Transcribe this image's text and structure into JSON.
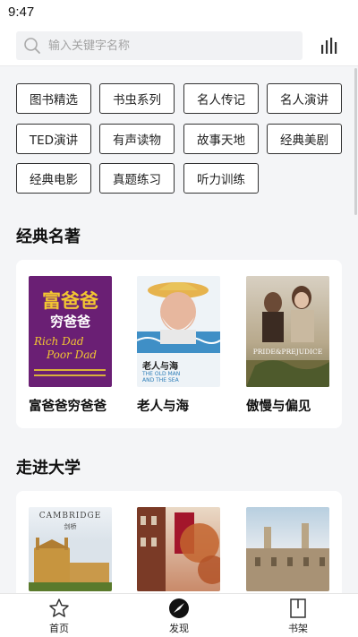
{
  "status": {
    "time": "9:47"
  },
  "search": {
    "placeholder": "输入关键字名称"
  },
  "tags": [
    "图书精选",
    "书虫系列",
    "名人传记",
    "名人演讲",
    "TED演讲",
    "有声读物",
    "故事天地",
    "经典美剧",
    "经典电影",
    "真题练习",
    "听力训练"
  ],
  "sections": [
    {
      "title": "经典名著",
      "books": [
        {
          "title": "富爸爸穷爸爸",
          "cover_text": [
            "富爸爸",
            "穷爸爸",
            "Rich Dad",
            "Poor Dad"
          ]
        },
        {
          "title": "老人与海",
          "cover_text": [
            "老人与海",
            "THE OLD MAN",
            "AND THE SEA"
          ]
        },
        {
          "title": "傲慢与偏见",
          "cover_text": [
            "PRIDE&PREJUDICE"
          ]
        }
      ]
    },
    {
      "title": "走进大学",
      "books": [
        {
          "title": "",
          "cover_text": [
            "CAMBRIDGE",
            "剑桥"
          ]
        },
        {
          "title": "",
          "cover_text": []
        },
        {
          "title": "",
          "cover_text": []
        }
      ]
    }
  ],
  "tabbar": [
    {
      "label": "首页",
      "icon": "star-icon"
    },
    {
      "label": "发现",
      "icon": "compass-icon"
    },
    {
      "label": "书架",
      "icon": "bookshelf-icon"
    }
  ],
  "colors": {
    "accent": "#111111",
    "background": "#f4f5f7",
    "card": "#ffffff"
  }
}
